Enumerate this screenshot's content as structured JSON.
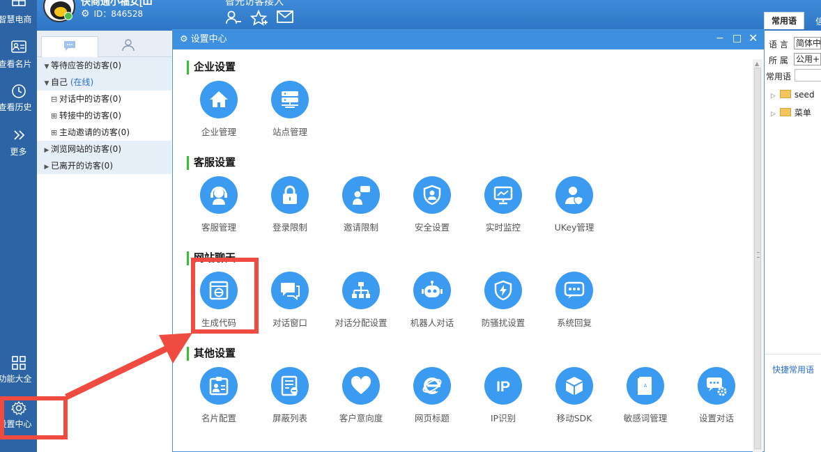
{
  "leftnav": {
    "items": [
      {
        "label": "智慧电商",
        "icon": "store-icon"
      },
      {
        "label": "查看名片",
        "icon": "card-icon"
      },
      {
        "label": "查看历史",
        "icon": "clock-icon"
      },
      {
        "label": "更多",
        "icon": "chevron-double-right-icon"
      },
      {
        "label": "功能大全",
        "icon": "grid-icon"
      },
      {
        "label": "设置中心",
        "icon": "gear-icon"
      }
    ]
  },
  "profile": {
    "name": "快商通小福女[Ш",
    "id_text": "ID：846528"
  },
  "toolbar": {
    "title": "智光访客接入"
  },
  "visitor_panel": {
    "rows": [
      {
        "label": "等待应答的访客(0)"
      },
      {
        "label": "自己",
        "status": "(在线)"
      },
      {
        "label": "对话中的访客(0)"
      },
      {
        "label": "转接中的访客(0)"
      },
      {
        "label": "主动邀请的访客(0)"
      },
      {
        "label": "浏览网站的访客(0)"
      },
      {
        "label": "已离开的访客(0)"
      }
    ]
  },
  "dialog": {
    "title": "设置中心",
    "sections": [
      {
        "title": "企业设置",
        "items": [
          "企业管理",
          "站点管理"
        ]
      },
      {
        "title": "客服设置",
        "items": [
          "客服管理",
          "登录限制",
          "邀请限制",
          "安全设置",
          "实时监控",
          "UKey管理"
        ]
      },
      {
        "title": "网站聊天",
        "items": [
          "生成代码",
          "对话窗口",
          "对话分配设置",
          "机器人对话",
          "防骚扰设置",
          "系统回复"
        ]
      },
      {
        "title": "其他设置",
        "items": [
          "名片配置",
          "屏蔽列表",
          "客户意向度",
          "网页标题",
          "IP识别",
          "移动SDK",
          "敏感词管理",
          "设置对话"
        ]
      }
    ]
  },
  "right_panel": {
    "tab": "常用语",
    "tab2": "信",
    "language_label": "语 言",
    "language_value": "简体中",
    "owner_label": "所 属",
    "owner_value": "公用+自",
    "phrase_label": "常用语",
    "tree": [
      "seed",
      "菜单"
    ],
    "quick_link": "快捷常用语"
  },
  "colors": {
    "accent": "#3a9bf0",
    "nav_bg": "#2c64a5",
    "section_bar": "#31c12f",
    "annotation": "#f04b40"
  }
}
